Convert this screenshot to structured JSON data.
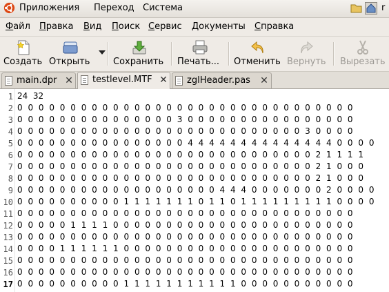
{
  "top_panel": {
    "menus": [
      "Приложения",
      "Переход",
      "Система"
    ],
    "tray_text": "r"
  },
  "menubar": {
    "items": [
      {
        "first": "Ф",
        "rest": "айл"
      },
      {
        "first": "П",
        "rest": "равка"
      },
      {
        "first": "В",
        "rest": "ид"
      },
      {
        "first": "П",
        "rest": "оиск"
      },
      {
        "first": "С",
        "rest": "ервис"
      },
      {
        "first": "Д",
        "rest": "окументы"
      },
      {
        "first": "С",
        "rest": "правка"
      }
    ]
  },
  "toolbar": {
    "new_label": "Создать",
    "open_label": "Открыть",
    "save_label": "Сохранить",
    "print_label": "Печать...",
    "undo_label": "Отменить",
    "redo_label": "Вернуть",
    "cut_label": "Вырезать"
  },
  "tabs": [
    {
      "label": "main.dpr"
    },
    {
      "label": "testlevel.MTF"
    },
    {
      "label": "zglHeader.pas"
    }
  ],
  "editor": {
    "lines": [
      "24  32",
      "0 0 0 0 0 0 0 0 0 0 0 0 0 0 0 0 0 0 0 0 0 0 0 0 0 0 0 0 0 0 0 0",
      "0 0 0 0 0 0 0 0 0 0 0 0 0 0 0 3 0 0 0 0 0 0 0 0 0 0 0 0 0 0 0 0",
      "0 0 0 0 0 0 0 0 0 0 0 0 0 0 0 0 0 0 0 0 0 0 0 0 0 0 0 3 0 0 0 0",
      "0 0 0 0 0 0 0 0 0 0 0 0 0 0 0 0 4 4 4 4 4 4 4 4 4 4 4 4 4 4 0 0 0 0",
      "0 0 0 0 0 0 0 0 0 0 0 0 0 0 0 0 0 0 0 0 0 0 0 0 0 0 0 0 2 1 1 1 1",
      "0 0 0 0 0 0 0 0 0 0 0 0 0 0 0 0 0 0 0 0 0 0 0 0 0 0 0 0 2 1 0 0 0",
      "0 0 0 0 0 0 0 0 0 0 0 0 0 0 0 0 0 0 0 0 0 0 0 0 0 0 0 0 2 1 0 0 0",
      "0 0 0 0 0 0 0 0 0 0 0 0 0 0 0 0 0 0 0 4 4 4 0 0 0 0 0 0 0 2 0 0 0 0",
      "0 0 0 0 0 0 0 0 0 0 1 1 1 1 1 1 1 0 1 1 0 1 1 1 1 1 1 1 1 1 0 0 0 0",
      "0 0 0 0 0 0 0 0 0 0 0 0 0 0 0 0 0 0 0 0 0 0 0 0 0 0 0 0 0 0 0 0",
      "0 0 0 0 0 1 1 1 1 0 0 0 0 0 0 0 0 0 0 0 0 0 0 0 0 0 0 0 0 0 0 0",
      "0 0 0 0 0 0 0 0 0 0 0 0 0 0 0 0 0 0 0 0 0 0 0 0 0 0 0 0 0 0 0 0",
      "0 0 0 0 1 1 1 1 1 1 0 0 0 0 0 0 0 0 0 0 0 0 0 0 0 0 0 0 0 0 0 0",
      "0 0 0 0 0 0 0 0 0 0 0 0 0 0 0 0 0 0 0 0 0 0 0 0 0 0 0 0 0 0 0 0",
      "0 0 0 0 0 0 0 0 0 0 0 0 0 0 0 0 0 0 0 0 0 0 0 0 0 0 0 0 0 0 0 0",
      "0 0 0 0 0 0 0 0 0 0 1 1 1 1 1 1 1 1 1 1 1 0 0 0 0 0 0 0 0 0 0 0"
    ],
    "line_numbers": [
      "1",
      "2",
      "3",
      "4",
      "5",
      "6",
      "7",
      "8",
      "9",
      "10",
      "11",
      "12",
      "13",
      "14",
      "15",
      "16",
      "17"
    ]
  },
  "colors": {
    "panel_bg": "#efebe6",
    "ubuntu_orange": "#dd4814"
  },
  "icons": {
    "new": "new-document-icon",
    "open": "open-folder-icon",
    "save": "save-download-icon",
    "print": "printer-icon",
    "undo": "undo-arrow-icon",
    "redo": "redo-arrow-icon",
    "cut": "scissors-icon"
  }
}
